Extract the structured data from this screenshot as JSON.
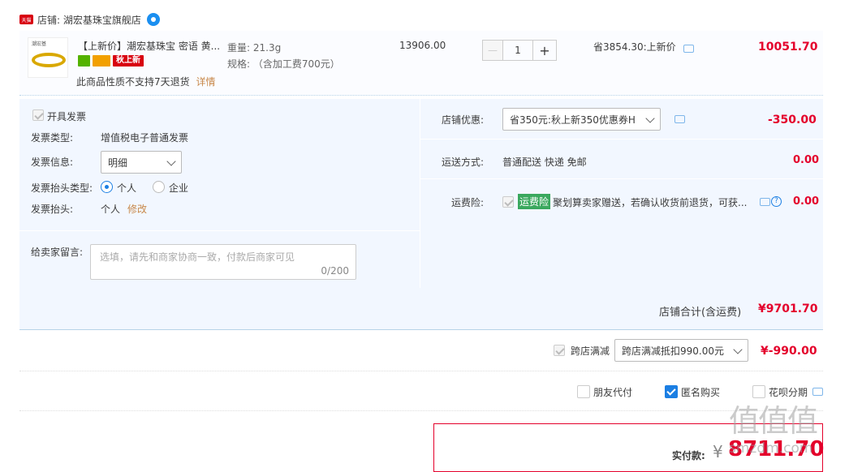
{
  "shop": {
    "badge": "天猫",
    "label": "店铺: 湖宏基珠宝旗舰店"
  },
  "item": {
    "thumb_text": "潮宏基",
    "title": "【上新价】潮宏基珠宝 密语 黄...",
    "new_badge": "秋上新",
    "return_note": "此商品性质不支持7天退货",
    "return_link": "详情",
    "weight": "重量: 21.3g",
    "spec": "规格: （含加工费700元）",
    "unit_price": "13906.00",
    "quantity": "1",
    "minus": "—",
    "plus": "+",
    "discount_text": "省3854.30:上新价",
    "line_total": "10051.70"
  },
  "invoice": {
    "open_label": "开具发票",
    "type_label": "发票类型:",
    "type_value": "增值税电子普通发票",
    "info_label": "发票信息:",
    "info_value": "明细",
    "title_type_label": "发票抬头类型:",
    "title_type_options": [
      "个人",
      "企业"
    ],
    "title_label": "发票抬头:",
    "title_value": "个人",
    "title_edit": "修改",
    "message_label": "给卖家留言:",
    "message_placeholder": "选填，请先和商家协商一致，付款后商家可见",
    "message_count": "0/200"
  },
  "order": {
    "coupon_label": "店铺优惠:",
    "coupon_value": "省350元:秋上新350优惠券H",
    "coupon_amount": "-350.00",
    "shipping_label": "运送方式:",
    "shipping_value": "普通配送 快递 免邮",
    "shipping_amount": "0.00",
    "insurance_label": "运费险:",
    "insurance_tag": "运费险",
    "insurance_text": "聚划算卖家赠送，若确认收货前退货，可获...",
    "insurance_amount": "0.00"
  },
  "subtotal": {
    "label": "店铺合计(含运费)",
    "value": "¥9701.70"
  },
  "cross_store": {
    "label": "跨店满减",
    "select_value": "跨店满减抵扣990.00元",
    "amount": "¥-990.00"
  },
  "options": {
    "friend_pay": "朋友代付",
    "anonymous": "匿名购买",
    "huabei": "花呗分期"
  },
  "payment": {
    "label": "实付款:",
    "currency": "¥",
    "amount": "8711.70"
  },
  "watermark": {
    "logo": "值值值",
    "site": "smzdm.com"
  },
  "colors": {
    "price_red": "#e4002b",
    "panel_bg": "#f2f7ff",
    "accent_blue": "#1b7fe3"
  }
}
